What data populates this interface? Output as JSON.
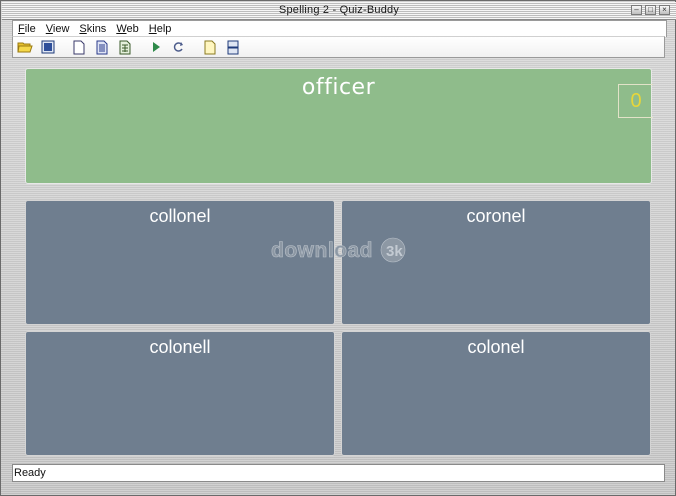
{
  "window": {
    "title": "Spelling 2 - Quiz-Buddy",
    "controls": [
      "minimize",
      "maximize",
      "close"
    ]
  },
  "menu": {
    "items": [
      "File",
      "View",
      "Skins",
      "Web",
      "Help"
    ]
  },
  "toolbar": {
    "buttons": [
      {
        "name": "open-folder-icon"
      },
      {
        "name": "window-icon"
      },
      {
        "name": "new-document-icon"
      },
      {
        "name": "grid-document-icon"
      },
      {
        "name": "table-document-icon"
      },
      {
        "name": "play-icon"
      },
      {
        "name": "refresh-icon"
      },
      {
        "name": "note-document-icon"
      },
      {
        "name": "split-view-icon"
      }
    ]
  },
  "quiz": {
    "question": "officer",
    "score": "0",
    "answers": [
      "collonel",
      "coronel",
      "colonell",
      "colonel"
    ]
  },
  "watermark": "download3k",
  "status": {
    "text": "Ready"
  },
  "colors": {
    "question_panel": "#8fbc8b",
    "answer_panel": "#6f7e8f",
    "score_text": "#e8d63a"
  }
}
